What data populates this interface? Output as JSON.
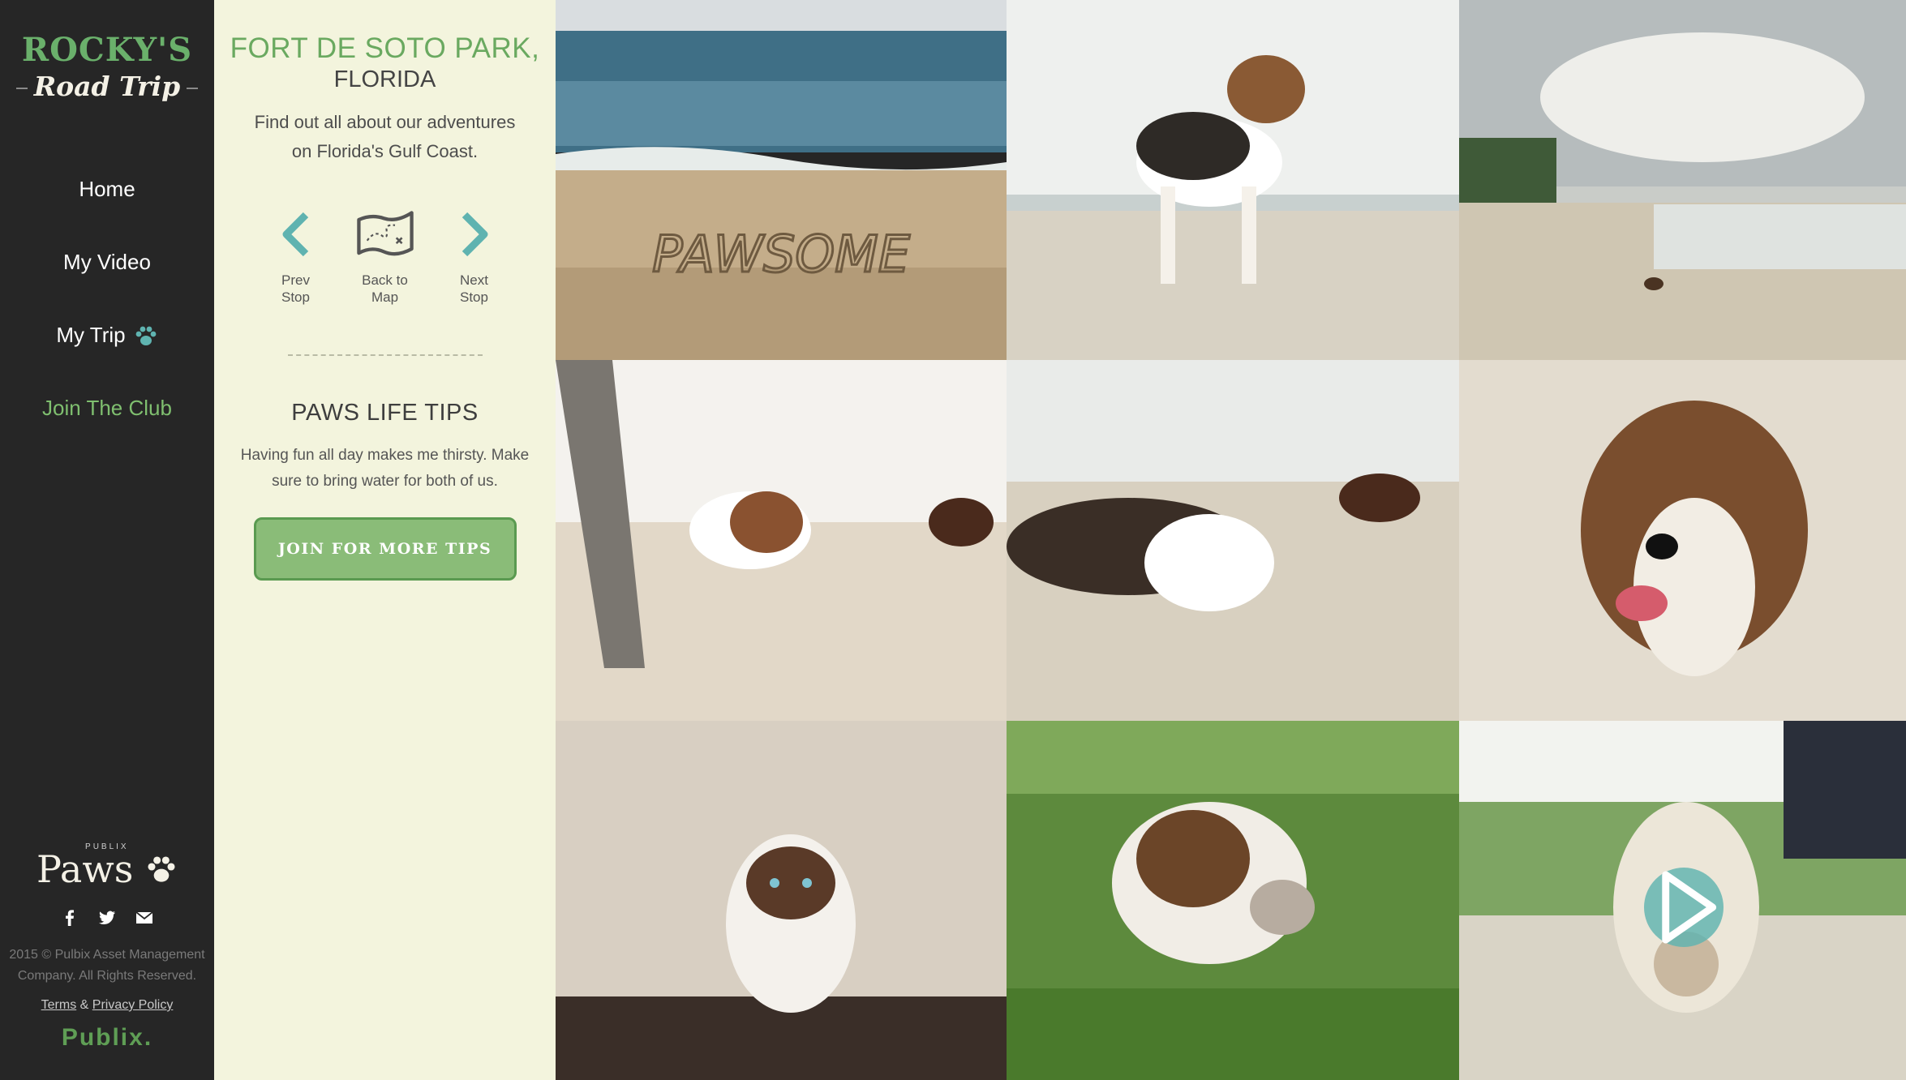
{
  "logo": {
    "line1": "ROCKY'S",
    "line2": "Road Trip"
  },
  "nav": {
    "home": "Home",
    "video": "My Video",
    "trip": "My Trip",
    "club": "Join The Club"
  },
  "footer": {
    "brand_small": "PUBLIX",
    "brand": "Paws",
    "copyright_line1": "2015 © Pulbix Asset Management",
    "copyright_line2": "Company. All Rights Reserved.",
    "terms": "Terms",
    "amp": "&",
    "privacy": "Privacy Policy",
    "publix": "Publix."
  },
  "info": {
    "location_title": "FORT DE SOTO PARK,",
    "location_state": "FLORIDA",
    "intro": "Find out all about our adventures on Florida's Gulf Coast.",
    "prev_label": "Prev Stop",
    "map_label": "Back to Map",
    "next_label": "Next Stop",
    "tips_title": "PAWS LIFE TIPS",
    "tips_text": "Having fun all day makes me thirsty. Make sure to bring water for both of us.",
    "join_button": "JOIN FOR MORE TIPS"
  },
  "photos": [
    {
      "name": "photo-pawsome-sand",
      "sand_text": "PAWSOME"
    },
    {
      "name": "photo-beagle-standing"
    },
    {
      "name": "photo-beach-dogs-far"
    },
    {
      "name": "photo-beagle-walking-shore"
    },
    {
      "name": "photo-beagle-and-lab"
    },
    {
      "name": "photo-beagle-closeup"
    },
    {
      "name": "photo-cat"
    },
    {
      "name": "photo-beagle-grass"
    },
    {
      "name": "photo-video-beagle"
    }
  ],
  "colors": {
    "sidebar": "#262626",
    "panel": "#f3f4dd",
    "accent_green": "#6aa960",
    "teal_arrow": "#5fb3b0"
  }
}
